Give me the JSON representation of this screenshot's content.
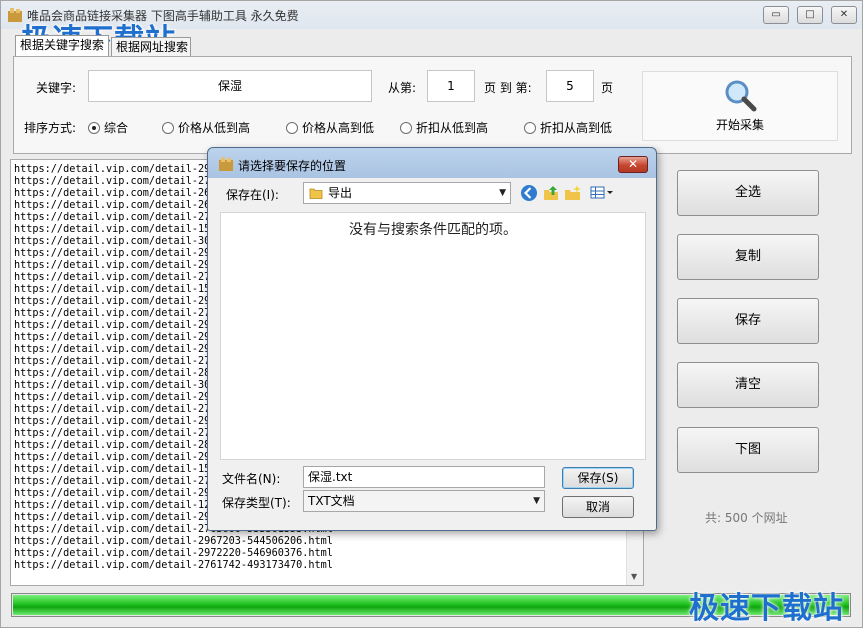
{
  "window": {
    "title": "唯品会商品链接采集器  下图高手辅助工具  永久免费",
    "controls": {
      "minimize": "▭",
      "maximize": "□",
      "close": "✕"
    }
  },
  "watermark": {
    "top": "极速下载站",
    "bottom": "极速下载站"
  },
  "tabs": [
    {
      "label": "根据关键字搜索",
      "active": true
    },
    {
      "label": "根据网址搜索",
      "active": false
    }
  ],
  "search": {
    "keyword_label": "关键字:",
    "keyword_value": "保湿",
    "from_label": "从第:",
    "from_value": "1",
    "page_to_label": "页 到 第:",
    "to_value": "5",
    "page_label": "页",
    "sort_label": "排序方式:",
    "sort_options": [
      {
        "label": "综合",
        "selected": true
      },
      {
        "label": "价格从低到高",
        "selected": false
      },
      {
        "label": "价格从高到低",
        "selected": false
      },
      {
        "label": "折扣从低到高",
        "selected": false
      },
      {
        "label": "折扣从高到低",
        "selected": false
      }
    ],
    "start_label": "开始采集"
  },
  "url_list": {
    "rows": [
      "https://detail.vip.com/detail-29",
      "https://detail.vip.com/detail-27",
      "https://detail.vip.com/detail-26",
      "https://detail.vip.com/detail-26",
      "https://detail.vip.com/detail-27",
      "https://detail.vip.com/detail-15",
      "https://detail.vip.com/detail-30",
      "https://detail.vip.com/detail-29",
      "https://detail.vip.com/detail-29",
      "https://detail.vip.com/detail-27",
      "https://detail.vip.com/detail-15",
      "https://detail.vip.com/detail-29",
      "https://detail.vip.com/detail-27",
      "https://detail.vip.com/detail-29",
      "https://detail.vip.com/detail-29",
      "https://detail.vip.com/detail-29",
      "https://detail.vip.com/detail-27",
      "https://detail.vip.com/detail-28",
      "https://detail.vip.com/detail-30",
      "https://detail.vip.com/detail-29",
      "https://detail.vip.com/detail-27",
      "https://detail.vip.com/detail-29",
      "https://detail.vip.com/detail-27",
      "https://detail.vip.com/detail-28",
      "https://detail.vip.com/detail-29",
      "https://detail.vip.com/detail-15",
      "https://detail.vip.com/detail-27",
      "https://detail.vip.com/detail-29",
      "https://detail.vip.com/detail-12",
      "https://detail.vip.com/detail-2962880-550065216.html",
      "https://detail.vip.com/detail-2763600-533361353.html",
      "https://detail.vip.com/detail-2967203-544506206.html",
      "https://detail.vip.com/detail-2972220-546960376.html",
      "https://detail.vip.com/detail-2761742-493173470.html"
    ]
  },
  "side_buttons": {
    "select_all": "全选",
    "copy": "复制",
    "save": "保存",
    "clear": "清空",
    "download": "下图"
  },
  "status": {
    "total": "共: 500  个网址"
  },
  "progress": {
    "percent": 100
  },
  "dialog": {
    "title": "请选择要保存的位置",
    "save_in_label": "保存在(I):",
    "save_in_value": "导出",
    "empty_message": "没有与搜索条件匹配的项。",
    "filename_label": "文件名(N):",
    "filename_value": "保湿.txt",
    "filetype_label": "保存类型(T):",
    "filetype_value": "TXT文档",
    "save_button": "保存(S)",
    "cancel_button": "取消"
  },
  "colors": {
    "accent": "#1f6fcf",
    "progress": "#22c322"
  }
}
